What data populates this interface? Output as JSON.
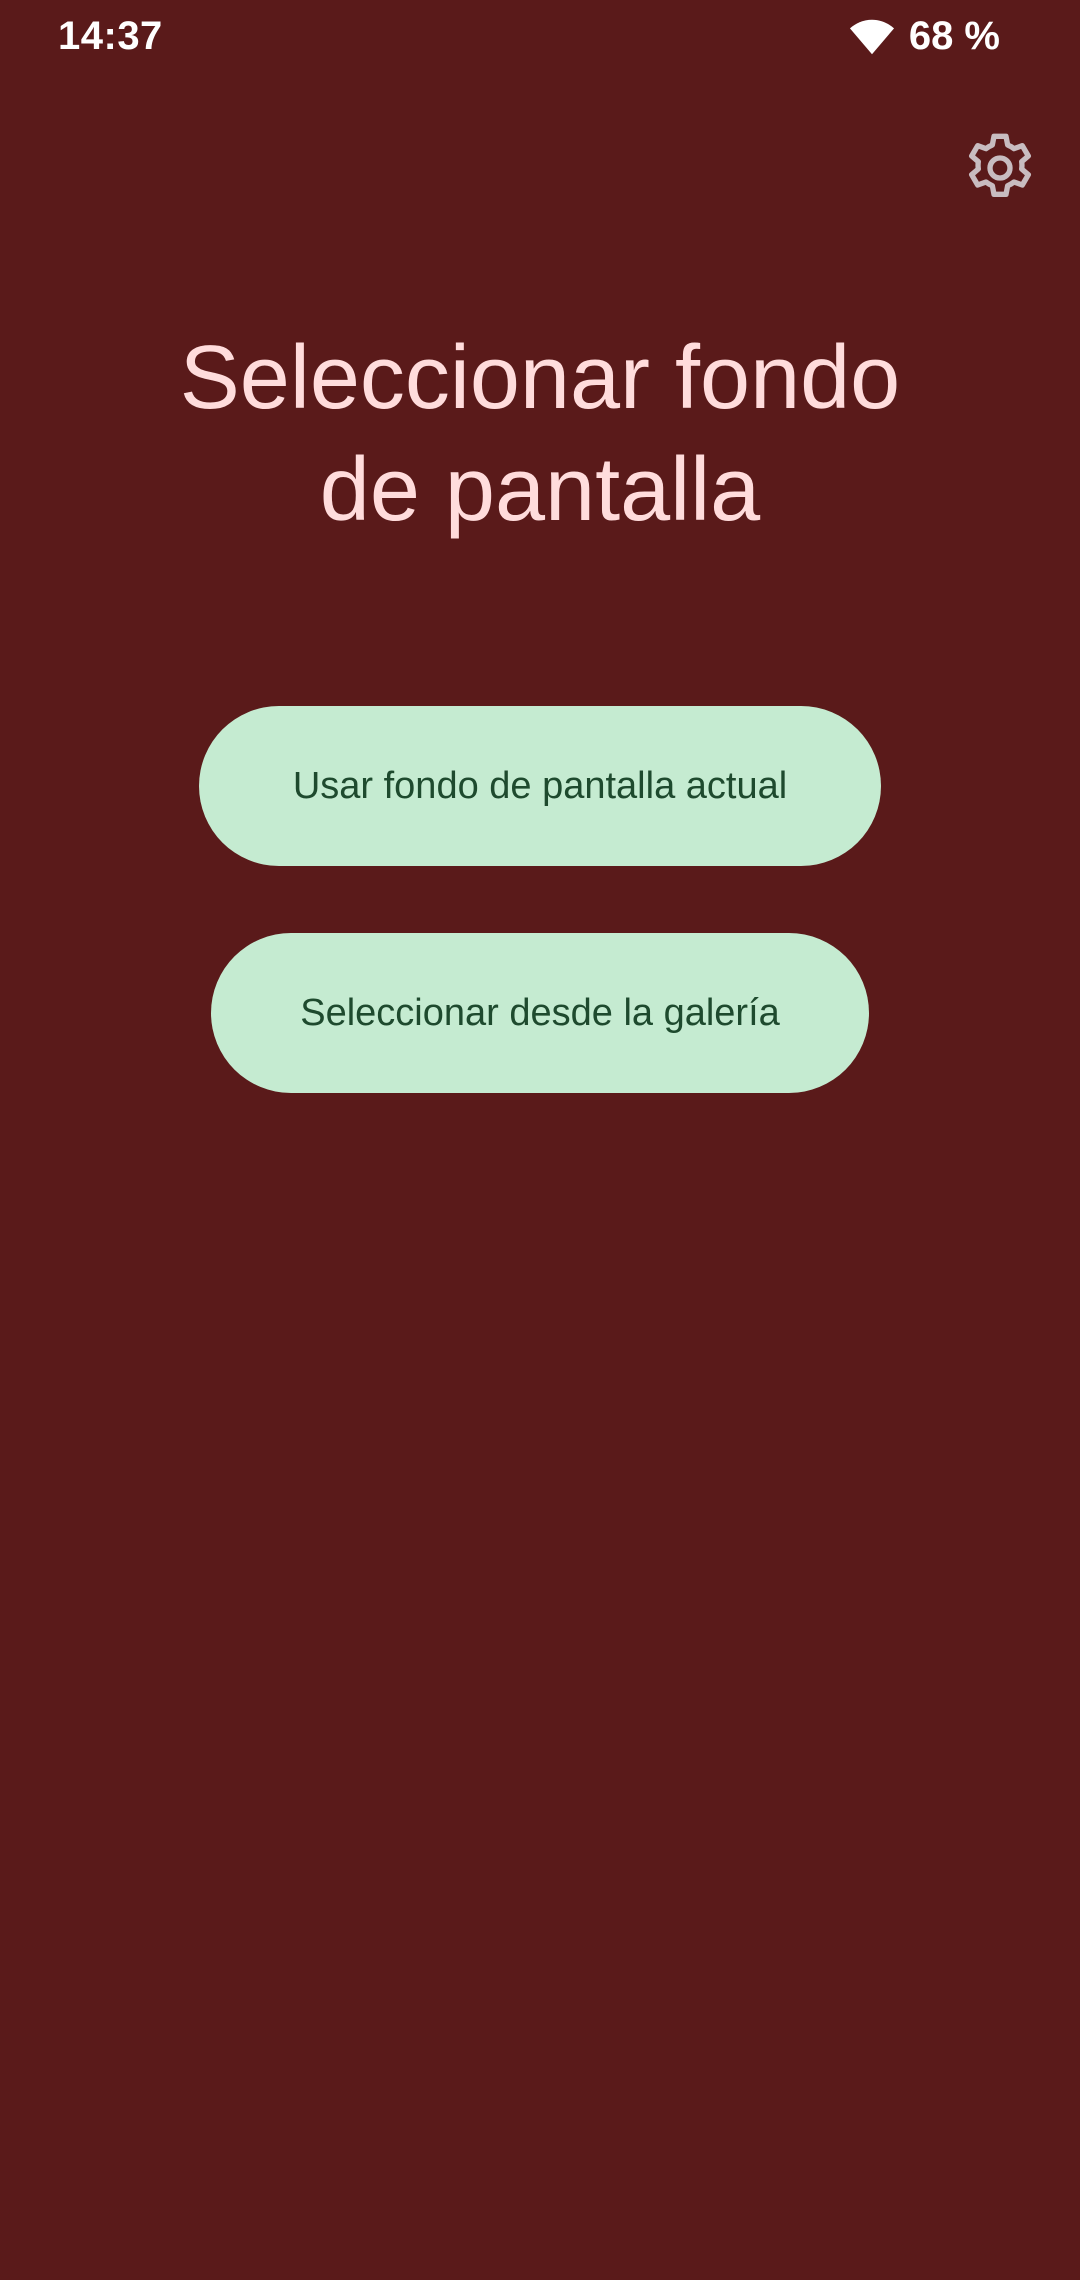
{
  "status_bar": {
    "time": "14:37",
    "battery": "68 %",
    "wifi_icon": "wifi-icon"
  },
  "settings": {
    "icon": "gear-icon"
  },
  "title": {
    "line1": "Seleccionar fondo",
    "line2": "de pantalla"
  },
  "buttons": {
    "use_current": "Usar fondo de pantalla actual",
    "select_gallery": "Seleccionar desde la galería"
  },
  "colors": {
    "background": "#5a1a1a",
    "title_text": "#ffdcdc",
    "button_bg": "#c5ebd1",
    "button_text": "#1e4a2e",
    "icon_gray": "#c8bcc0"
  }
}
